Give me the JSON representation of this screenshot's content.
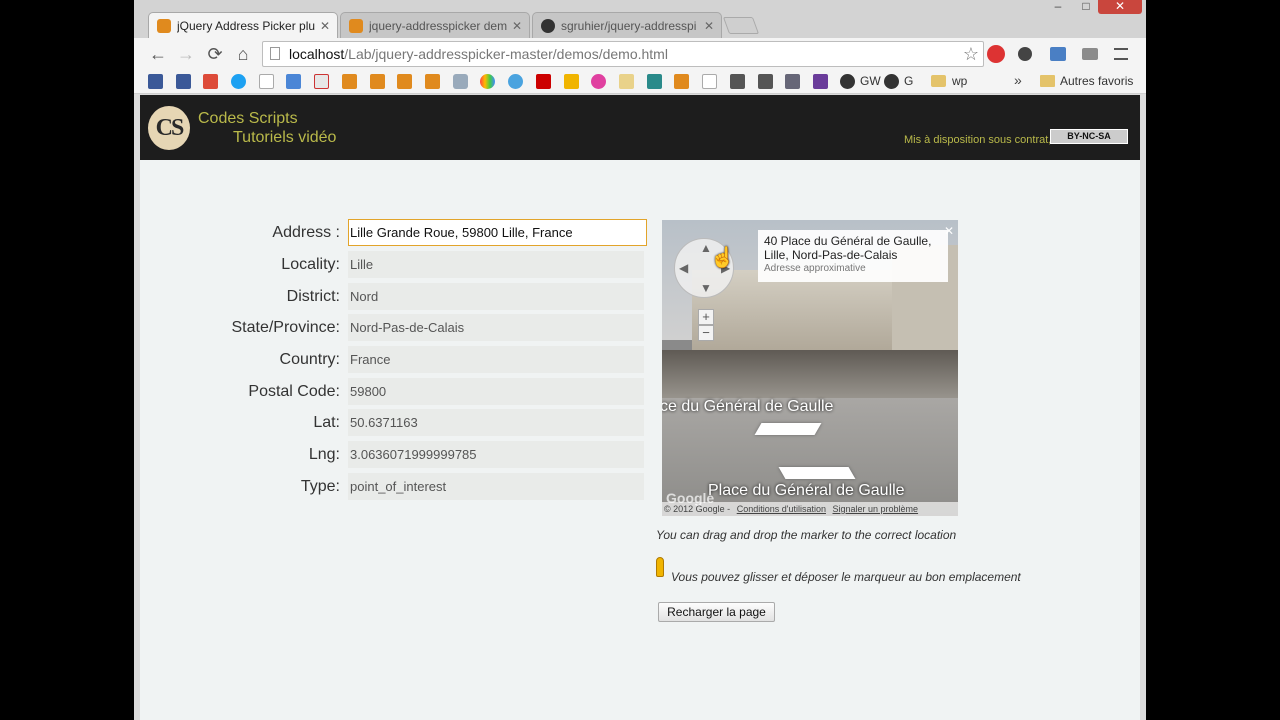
{
  "browser": {
    "tabs": [
      {
        "title": "jQuery Address Picker plu",
        "icon": "codes-scripts-favicon",
        "active": true
      },
      {
        "title": "jquery-addresspicker dem",
        "icon": "codes-scripts-favicon",
        "active": false
      },
      {
        "title": "sgruhier/jquery-addresspi",
        "icon": "github-favicon",
        "active": false
      }
    ],
    "tab_close": "✕",
    "window": {
      "minimize": "–",
      "maximize": "□",
      "close": "✕"
    },
    "nav": {
      "back": "←",
      "forward": "→",
      "reload": "⟳",
      "home": "⌂"
    },
    "url_host": "localhost",
    "url_path": "/Lab/jquery-addresspicker-master/demos/demo.html",
    "star": "☆",
    "bookmarks": {
      "labels": [
        "GW",
        "G",
        "wp"
      ],
      "more": "»",
      "other_folder": "Autres favoris"
    }
  },
  "site": {
    "logo_initials": "CS",
    "logo_line1": "Codes Scripts",
    "logo_line2": "Tutoriels vidéo",
    "license_text": "Mis à disposition sous contrat,",
    "license_badge": "BY-NC-SA"
  },
  "form": {
    "address_label": "Address :",
    "address_value": "Lille Grande Roue, 59800 Lille, France",
    "fields": [
      {
        "label": "Locality:",
        "value": "Lille"
      },
      {
        "label": "District:",
        "value": "Nord"
      },
      {
        "label": "State/Province:",
        "value": "Nord-Pas-de-Calais"
      },
      {
        "label": "Country:",
        "value": "France"
      },
      {
        "label": "Postal Code:",
        "value": "59800"
      },
      {
        "label": "Lat:",
        "value": "50.6371163"
      },
      {
        "label": "Lng:",
        "value": "3.0636071999999785"
      },
      {
        "label": "Type:",
        "value": "point_of_interest"
      }
    ]
  },
  "streetview": {
    "info_line1": "40 Place du Général de Gaulle,",
    "info_line2": "Lille, Nord-Pas-de-Calais",
    "info_approx": "Adresse approximative",
    "close": "✕",
    "street_label_1": "ce du Général de Gaulle",
    "street_label_2": "Place du Général de Gaulle",
    "zoom_in": "+",
    "zoom_out": "−",
    "google_logo": "Google",
    "copyright": "© 2012 Google -",
    "terms_link": "Conditions d'utilisation",
    "report_link": "Signaler un problème"
  },
  "hints": {
    "english": "You can drag and drop the marker to the correct location",
    "french": "Vous pouvez glisser et déposer le marqueur au bon emplacement"
  },
  "reload_button": "Recharger la page",
  "colors": {
    "accent_input_border": "#e2a42a",
    "header_bg": "#1d1d1d",
    "logo_text": "#b9b94a"
  }
}
